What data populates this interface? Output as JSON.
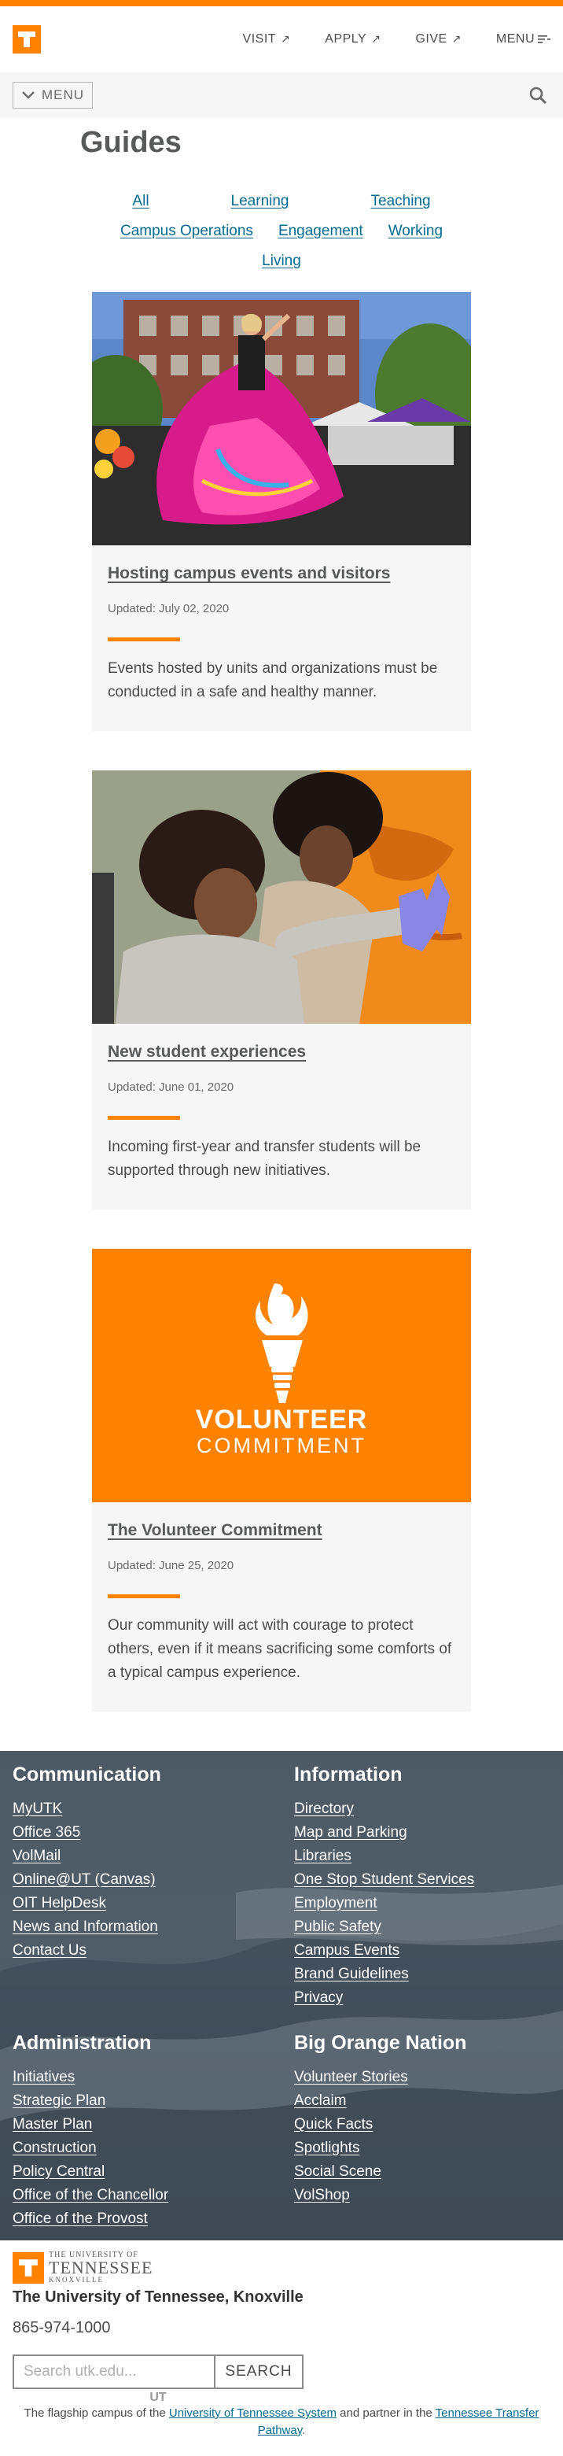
{
  "header": {
    "logo_letter": "T",
    "links": [
      {
        "label": "VISIT",
        "icon": "external-arrow-icon"
      },
      {
        "label": "APPLY",
        "icon": "external-arrow-icon"
      },
      {
        "label": "GIVE",
        "icon": "external-arrow-icon"
      }
    ],
    "menu_label": "MENU"
  },
  "subbar": {
    "menu_label": "MENU"
  },
  "page": {
    "title": "Guides"
  },
  "filters": [
    "All",
    "Learning",
    "Teaching",
    "Campus Operations",
    "Engagement",
    "Working",
    "Living"
  ],
  "cards": [
    {
      "title": "Hosting campus events and visitors",
      "date": "Updated: July 02, 2020",
      "description": "Events hosted by units and organizations must be conducted in a safe and healthy manner."
    },
    {
      "title": "New student experiences",
      "date": "Updated: June 01, 2020",
      "description": "Incoming first-year and transfer students will be supported through new initiatives."
    },
    {
      "title": "The Volunteer Commitment",
      "date": "Updated: June 25, 2020",
      "description": "Our community will act with courage to protect others, even if it means sacrificing some comforts of a typical campus experience.",
      "image_text": {
        "line1": "VOLUNTEER",
        "line2": "COMMITMENT"
      }
    }
  ],
  "footer": {
    "sections": [
      {
        "heading": "Communication",
        "links": [
          "MyUTK",
          "Office 365",
          "VolMail",
          "Online@UT (Canvas)",
          "OIT HelpDesk",
          "News and Information",
          "Contact Us"
        ]
      },
      {
        "heading": "Information",
        "links": [
          "Directory",
          "Map and Parking",
          "Libraries",
          "One Stop Student Services",
          "Employment",
          "Public Safety",
          "Campus Events",
          "Brand Guidelines",
          "Privacy"
        ]
      },
      {
        "heading": "Administration",
        "links": [
          "Initiatives",
          "Strategic Plan",
          "Master Plan",
          "Construction",
          "Policy Central",
          "Office of the Chancellor",
          "Office of the Provost"
        ]
      },
      {
        "heading": "Big Orange Nation",
        "links": [
          "Volunteer Stories",
          "Acclaim",
          "Quick Facts",
          "Spotlights",
          "Social Scene",
          "VolShop"
        ]
      }
    ]
  },
  "bottom": {
    "wordmark": {
      "line1": "THE UNIVERSITY OF",
      "line2": "TENNESSEE",
      "line3": "KNOXVILLE"
    },
    "university_name": "The University of Tennessee, Knoxville",
    "phone": "865-974-1000",
    "search_placeholder": "Search utk.edu...",
    "search_button": "SEARCH",
    "ut_mark": "UT",
    "flagship_prefix": "The flagship campus of the ",
    "flagship_link1": "University of Tennessee System",
    "flagship_middle": " and partner in the ",
    "flagship_link2": "Tennessee Transfer Pathway",
    "flagship_suffix": "."
  },
  "colors": {
    "brand_orange": "#ff8200",
    "link_blue": "#006c93",
    "smokey_gray": "#58595b",
    "footer_slate": "#4d5a66"
  }
}
